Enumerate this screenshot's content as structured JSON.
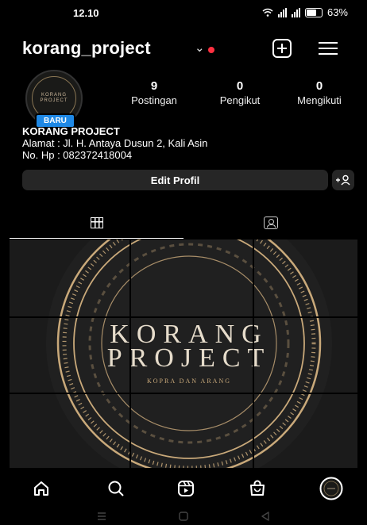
{
  "status_bar": {
    "time": "12.10",
    "battery": "63%"
  },
  "header": {
    "username": "korang_project",
    "chevron_icon": "chevron-down-icon",
    "notification_color": "#ff3040",
    "create_icon": "plus-square-icon",
    "menu_icon": "hamburger-menu-icon"
  },
  "profile": {
    "avatar_text_line1": "KORANG",
    "avatar_text_line2": "PROJECT",
    "badge": "BARU",
    "badge_color": "#1e88e5",
    "stats": [
      {
        "value": "9",
        "label": "Postingan"
      },
      {
        "value": "0",
        "label": "Pengikut"
      },
      {
        "value": "0",
        "label": "Mengikuti"
      }
    ],
    "name": "KORANG PROJECT",
    "bio_lines": [
      "Alamat : Jl. H. Antaya Dusun 2, Kali Asin",
      "No. Hp : 082372418004"
    ]
  },
  "actions": {
    "edit_label": "Edit Profil",
    "add_person_label": "+♀"
  },
  "tabs": [
    {
      "icon": "grid-icon",
      "active": true
    },
    {
      "icon": "tagged-person-icon",
      "active": false
    }
  ],
  "post": {
    "title_line1": "KORANG",
    "title_line2": "PROJECT",
    "tagline": "KOPRA DAN ARANG",
    "accent_color": "#c9a97a"
  },
  "bottom_nav": [
    {
      "icon": "home-icon"
    },
    {
      "icon": "search-icon"
    },
    {
      "icon": "reels-icon"
    },
    {
      "icon": "shop-icon"
    },
    {
      "icon": "profile-avatar-icon"
    }
  ],
  "system_nav": [
    {
      "icon": "recents-icon"
    },
    {
      "icon": "home-button-icon"
    },
    {
      "icon": "back-icon"
    }
  ]
}
